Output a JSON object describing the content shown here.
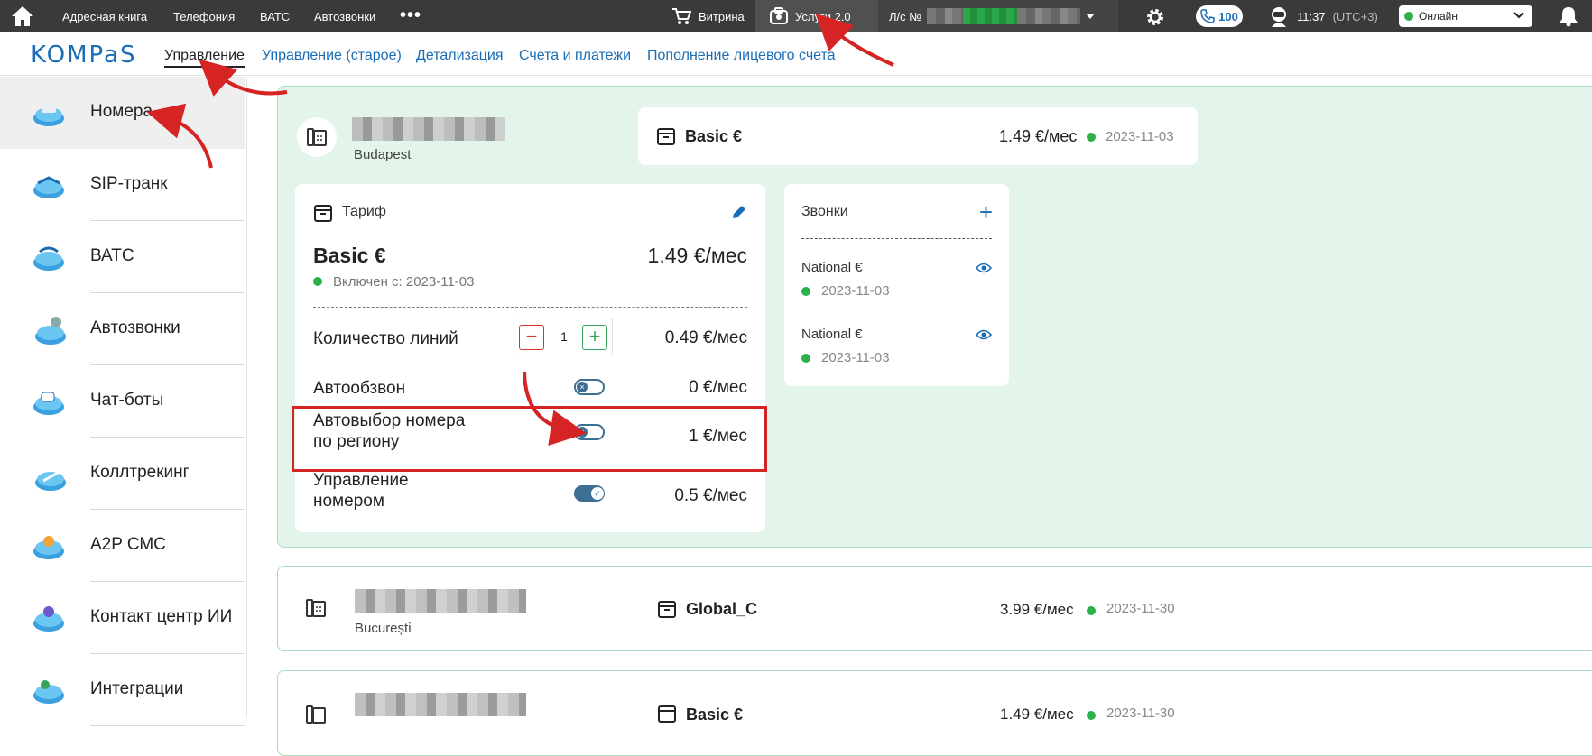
{
  "topbar": {
    "nav": [
      "Адресная книга",
      "Телефония",
      "ВАТС",
      "Автозвонки"
    ],
    "more": "•••",
    "vitrina": "Витрина",
    "uslugi": "Услуги 2.0",
    "ls_label": "Л/с №",
    "calls_count": "100",
    "time": "11:37",
    "tz": "(UTC+3)",
    "status": "Онлайн"
  },
  "subbar": {
    "logo": "KOMPaS",
    "tabs": [
      "Управление",
      "Управление (старое)",
      "Детализация",
      "Счета и платежи",
      "Пополнение лицевого счета"
    ]
  },
  "sidebar": {
    "items": [
      "Номера",
      "SIP-транк",
      "ВАТС",
      "Автозвонки",
      "Чат-боты",
      "Коллтрекинг",
      "A2P СМС",
      "Контакт центр ИИ",
      "Интеграции"
    ]
  },
  "main": {
    "number_city": "Budapest",
    "tariff_head": {
      "name": "Basic €",
      "price": "1.49 €/мес",
      "date": "2023-11-03"
    },
    "tariff_card": {
      "title": "Тариф",
      "name": "Basic €",
      "price": "1.49 €/мес",
      "since": "Включен с: 2023-11-03",
      "rows": [
        {
          "label": "Количество линий",
          "price": "0.49 €/мес",
          "value": "1"
        },
        {
          "label": "Автообзвон",
          "price": "0 €/мес"
        },
        {
          "label_line1": "Автовыбор номера",
          "label_line2": "по региону",
          "price": "1 €/мес"
        },
        {
          "label_line1": "Управление",
          "label_line2": "номером",
          "price": "0.5 €/мес"
        }
      ]
    },
    "calls": {
      "title": "Звонки",
      "items": [
        {
          "name": "National €",
          "date": "2023-11-03"
        },
        {
          "name": "National €",
          "date": "2023-11-03"
        }
      ]
    },
    "other_numbers": [
      {
        "city": "București",
        "tariff": "Global_C",
        "price": "3.99 €/мес",
        "date": "2023-11-30"
      },
      {
        "city": "",
        "tariff": "Basic €",
        "price": "1.49 €/мес",
        "date": "2023-11-30"
      }
    ]
  }
}
